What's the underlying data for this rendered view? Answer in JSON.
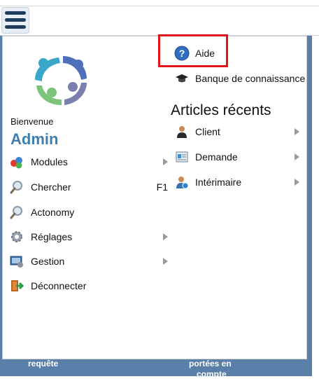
{
  "header": {
    "menu_icon": "hamburger-icon"
  },
  "background": {
    "label_left": "requête",
    "label_right_1": "portées en",
    "label_right_2": "compte"
  },
  "user": {
    "welcome": "Bienvenue",
    "name": "Admin",
    "logo_icon": "company-logo"
  },
  "menu": {
    "items": [
      {
        "label": "Modules",
        "icon": "modules-icon",
        "shortcut": ""
      },
      {
        "label": "Chercher",
        "icon": "search-icon",
        "shortcut": "F1"
      },
      {
        "label": "Actonomy",
        "icon": "search-icon",
        "shortcut": ""
      },
      {
        "label": "Réglages",
        "icon": "gear-icon",
        "shortcut": ""
      },
      {
        "label": "Gestion",
        "icon": "management-icon",
        "shortcut": ""
      },
      {
        "label": "Déconnecter",
        "icon": "logout-icon",
        "shortcut": ""
      }
    ]
  },
  "help": {
    "label": "Aide",
    "icon": "help-icon"
  },
  "knowledge": {
    "label": "Banque de connaissance",
    "icon": "graduation-cap-icon"
  },
  "recent": {
    "title": "Articles récents",
    "items": [
      {
        "label": "Client",
        "icon": "client-icon"
      },
      {
        "label": "Demande",
        "icon": "request-icon"
      },
      {
        "label": "Intérimaire",
        "icon": "temp-worker-icon"
      }
    ]
  },
  "colors": {
    "accent": "#3e7fae",
    "highlight_border": "#e0141a",
    "background_blue": "#5a7fa8"
  }
}
